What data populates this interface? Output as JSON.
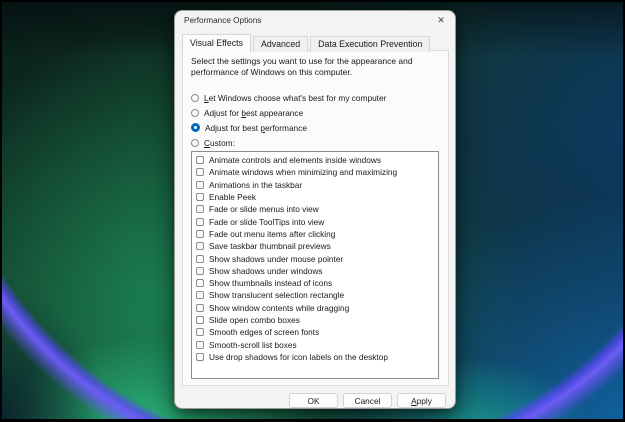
{
  "window": {
    "title": "Performance Options"
  },
  "icons": {
    "close": "✕"
  },
  "tabs": [
    {
      "name": "tab-visual-effects",
      "label": "Visual Effects",
      "active": true
    },
    {
      "name": "tab-advanced",
      "label": "Advanced",
      "active": false
    },
    {
      "name": "tab-data-execution-prevention",
      "label": "Data Execution Prevention",
      "active": false
    }
  ],
  "visual_effects": {
    "description": "Select the settings you want to use for the appearance and performance of Windows on this computer.",
    "radios": [
      {
        "name": "radio-let-windows-choose",
        "pre": "",
        "key": "L",
        "post": "et Windows choose what's best for my computer",
        "selected": false
      },
      {
        "name": "radio-adjust-best-appearance",
        "pre": "Adjust for ",
        "key": "b",
        "post": "est appearance",
        "selected": false
      },
      {
        "name": "radio-adjust-best-performance",
        "pre": "Adjust for best ",
        "key": "p",
        "post": "erformance",
        "selected": true
      },
      {
        "name": "radio-custom",
        "pre": "",
        "key": "C",
        "post": "ustom:",
        "selected": false
      }
    ],
    "effects": [
      {
        "label": "Animate controls and elements inside windows",
        "checked": false
      },
      {
        "label": "Animate windows when minimizing and maximizing",
        "checked": false
      },
      {
        "label": "Animations in the taskbar",
        "checked": false
      },
      {
        "label": "Enable Peek",
        "checked": false
      },
      {
        "label": "Fade or slide menus into view",
        "checked": false
      },
      {
        "label": "Fade or slide ToolTips into view",
        "checked": false
      },
      {
        "label": "Fade out menu items after clicking",
        "checked": false
      },
      {
        "label": "Save taskbar thumbnail previews",
        "checked": false
      },
      {
        "label": "Show shadows under mouse pointer",
        "checked": false
      },
      {
        "label": "Show shadows under windows",
        "checked": false
      },
      {
        "label": "Show thumbnails instead of icons",
        "checked": false
      },
      {
        "label": "Show translucent selection rectangle",
        "checked": false
      },
      {
        "label": "Show window contents while dragging",
        "checked": false
      },
      {
        "label": "Slide open combo boxes",
        "checked": false
      },
      {
        "label": "Smooth edges of screen fonts",
        "checked": false
      },
      {
        "label": "Smooth-scroll list boxes",
        "checked": false
      },
      {
        "label": "Use drop shadows for icon labels on the desktop",
        "checked": false
      }
    ]
  },
  "buttons": [
    {
      "name": "ok-button",
      "pre": "OK",
      "key": "",
      "post": ""
    },
    {
      "name": "cancel-button",
      "pre": "Cancel",
      "key": "",
      "post": ""
    },
    {
      "name": "apply-button",
      "pre": "",
      "key": "A",
      "post": "pply"
    }
  ],
  "colors": {
    "accent_blue": "#0067c0",
    "wallpaper_green": "#1d8a58",
    "wallpaper_blue": "#1166a8",
    "wallpaper_purple": "#6c5cf5",
    "wallpaper_teal": "#2ec686"
  }
}
